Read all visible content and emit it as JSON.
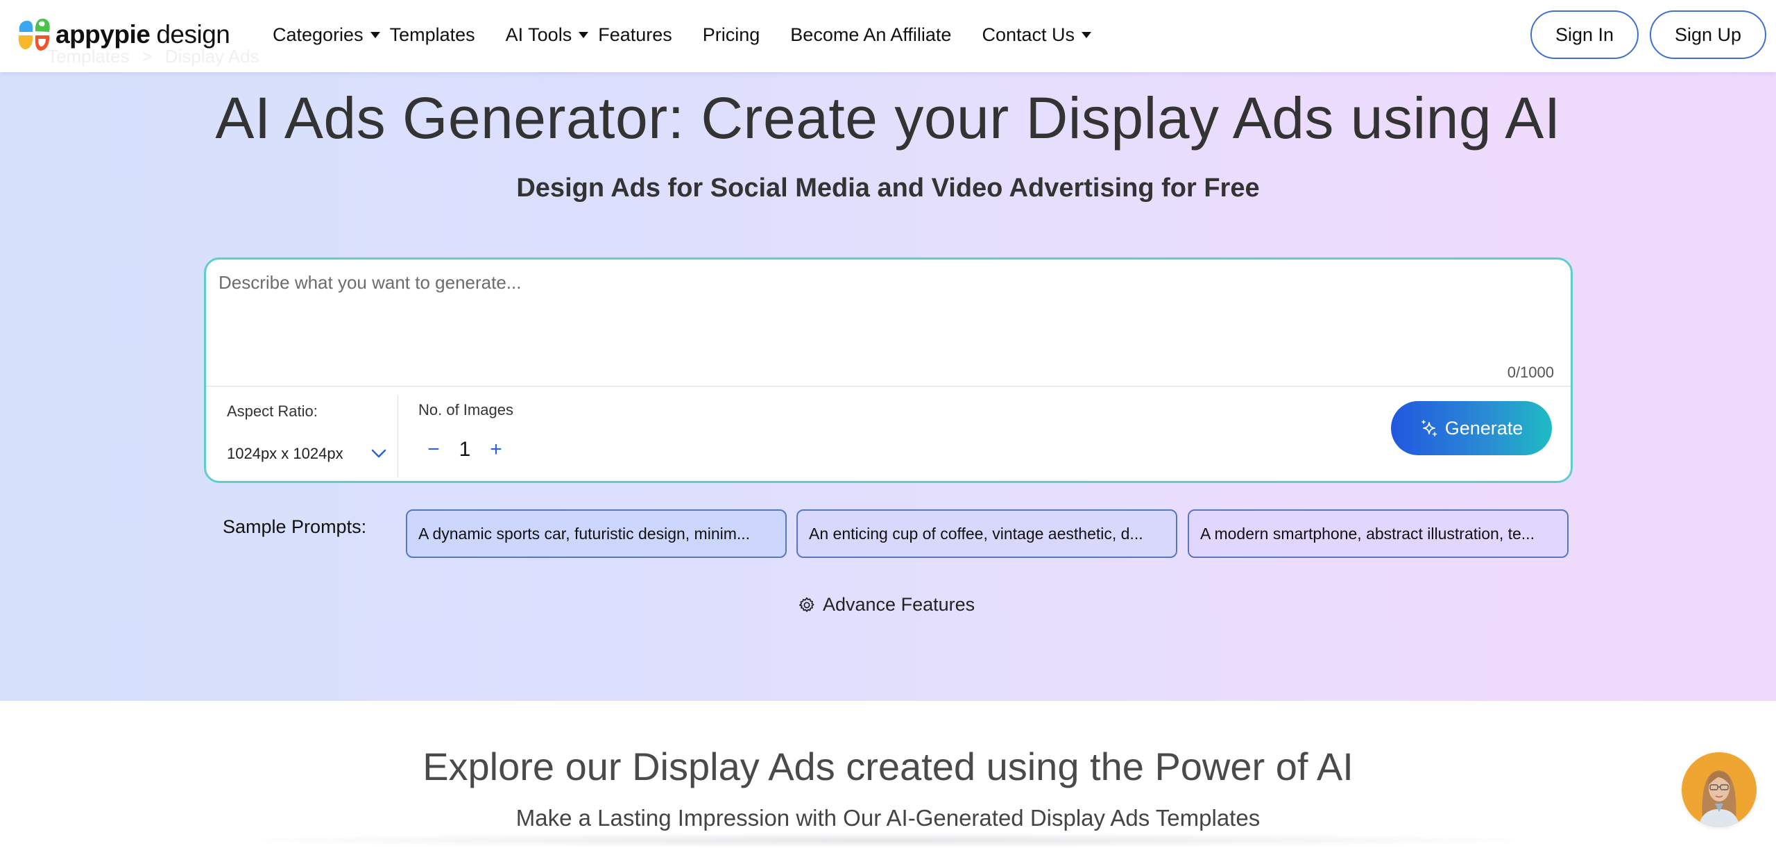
{
  "header": {
    "logo": {
      "brand_bold": "appypie",
      "brand_light": "design",
      "icon": "appypie-logo-icon"
    },
    "breadcrumb": [
      "Templates",
      ">",
      "Display Ads"
    ],
    "nav": [
      {
        "label": "Categories",
        "has_dropdown": true
      },
      {
        "label": "Templates",
        "has_dropdown": false
      },
      {
        "label": "AI Tools",
        "has_dropdown": true
      },
      {
        "label": "Features",
        "has_dropdown": false
      },
      {
        "label": "Pricing",
        "has_dropdown": false
      },
      {
        "label": "Become An Affiliate",
        "has_dropdown": false
      },
      {
        "label": "Contact Us",
        "has_dropdown": true
      }
    ],
    "sign_in": "Sign In",
    "sign_up": "Sign Up"
  },
  "hero": {
    "title": "AI Ads Generator: Create your Display Ads using AI",
    "subtitle": "Design Ads for Social Media and Video Advertising for Free"
  },
  "generator": {
    "prompt_placeholder": "Describe what you want to generate...",
    "prompt_value": "",
    "char_count": "0/1000",
    "aspect_ratio_label": "Aspect Ratio:",
    "aspect_ratio_value": "1024px x 1024px",
    "num_images_label": "No. of Images",
    "num_images_value": "1",
    "decrement_symbol": "−",
    "increment_symbol": "+",
    "generate_label": "Generate"
  },
  "samples": {
    "label": "Sample Prompts:",
    "prompts": [
      "A dynamic sports car, futuristic design, minim...",
      "An enticing cup of coffee, vintage aesthetic, d...",
      "A modern smartphone, abstract illustration, te..."
    ]
  },
  "advance_features": {
    "label": "Advance Features",
    "icon": "gear-icon"
  },
  "explore": {
    "title": "Explore our Display Ads created using the Power of AI",
    "subtitle": "Make a Lasting Impression with Our AI-Generated Display Ads Templates"
  },
  "colors": {
    "accent_blue": "#2257e0",
    "accent_teal": "#1ebcc4",
    "box_border": "#5fcdcd",
    "hero_left": "#d6e1fc",
    "hero_right": "#f0dafc",
    "chip_border": "#5877c2",
    "assistant_bg": "#efa531"
  }
}
